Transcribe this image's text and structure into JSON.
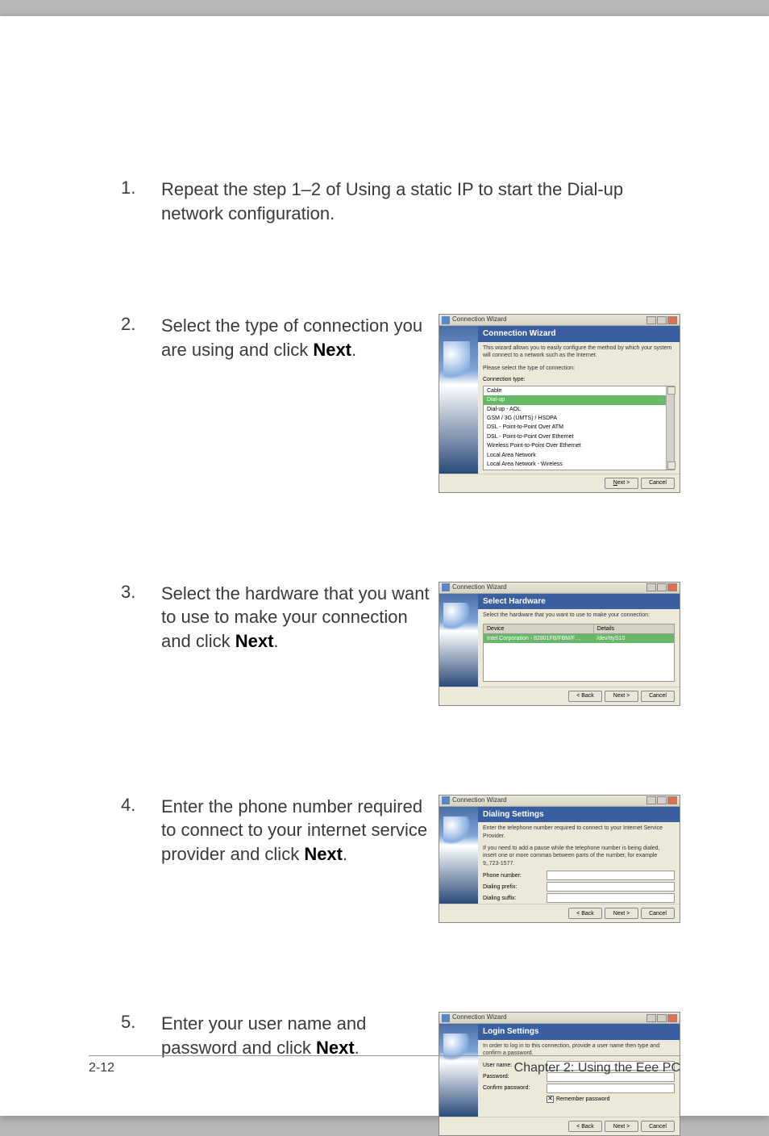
{
  "steps": {
    "s1": {
      "num": "1.",
      "text_a": "Repeat the step 1–2 of Using a static IP to start the Dial-up network configuration."
    },
    "s2": {
      "num": "2.",
      "text_a": "Select the type of connection you are using and click ",
      "bold": "Next",
      "text_b": "."
    },
    "s3": {
      "num": "3.",
      "text_a": "Select the hardware that you want to use to make your connection and click ",
      "bold": "Next",
      "text_b": "."
    },
    "s4": {
      "num": "4.",
      "text_a": "Enter the phone number required to connect to your internet service provider and click ",
      "bold": "Next",
      "text_b": "."
    },
    "s5": {
      "num": "5.",
      "text_a": "Enter your user name and password and click ",
      "bold": "Next",
      "text_b": "."
    }
  },
  "dialog_common": {
    "window_title": "Connection Wizard",
    "btn_back": "< Back",
    "btn_next": "Next >",
    "btn_cancel": "Cancel"
  },
  "dlg1": {
    "header": "Connection Wizard",
    "intro": "This wizard allows you to easily configure the method by which your system will connect to a network such as the Internet.",
    "please": "Please select the type of connection:",
    "label": "Connection type:",
    "items": [
      "Cable",
      "Dial-up",
      "Dial-up - AOL",
      "GSM / 3G (UMTS) / HSDPA",
      "DSL - Point-to-Point Over ATM",
      "DSL - Point-to-Point Over Ethernet",
      "Wireless Point-to-Point Over Ethernet",
      "Local Area Network",
      "Local Area Network - Wireless"
    ],
    "selected_index": 1
  },
  "dlg2": {
    "header": "Select Hardware",
    "intro": "Select the hardware that you want to use to make your connection:",
    "col1": "Device",
    "col2": "Details",
    "row_device": "Intel Corporation - 82801FB/FBM/F…",
    "row_details": "/dev/ttyS10"
  },
  "dlg3": {
    "header": "Dialing Settings",
    "intro": "Enter the telephone number required to connect to your Internet Service Provider.",
    "hint": "If you need to add a pause while the telephone number is being dialed, insert one or more commas between parts of the number, for example 9,,723-1577.",
    "f1": "Phone number:",
    "f2": "Dialing prefix:",
    "f3": "Dialing suffix:"
  },
  "dlg4": {
    "header": "Login Settings",
    "intro": "In order to log in to this connection, provide a user name then type and confirm a password.",
    "f1": "User name:",
    "f2": "Password:",
    "f3": "Confirm password:",
    "remember": "Remember password"
  },
  "footer": {
    "left": "2-12",
    "right": "Chapter 2: Using the Eee PC"
  }
}
